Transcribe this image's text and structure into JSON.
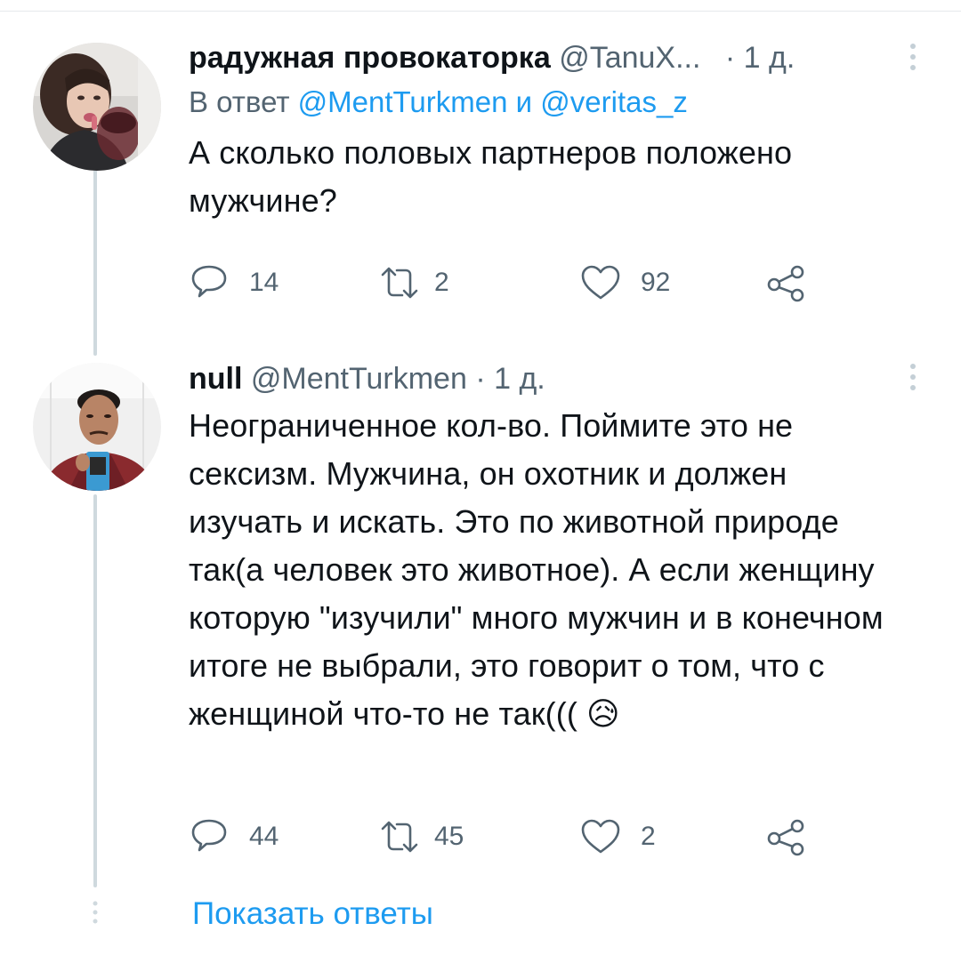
{
  "tweets": [
    {
      "display_name": "радужная провокаторка",
      "handle": "@TanuX...",
      "time": "· 1 д.",
      "reply_prefix": "В ответ",
      "reply_mention_1": "@MentTurkmen",
      "reply_and": "и",
      "reply_mention_2": "@veritas_z",
      "text": "А сколько половых партнеров положено мужчине?",
      "replies": "14",
      "retweets": "2",
      "likes": "92"
    },
    {
      "display_name": "null",
      "handle": "@MentTurkmen",
      "time": "· 1 д.",
      "text": "Неограниченное кол-во. Поймите это не сексизм. Мужчина, он охотник и должен изучать и искать. Это по животной природе так(а человек это животное). А если женщину которую \"изучили\" много мужчин и в конечном итоге не выбрали, это говорит о том, что с женщиной что-то не так(((",
      "emoji": "😥",
      "replies": "44",
      "retweets": "45",
      "likes": "2"
    }
  ],
  "show_replies_label": "Показать ответы",
  "colors": {
    "accent": "#1d9bf0",
    "secondary_text": "#536471",
    "primary_text": "#0f1419",
    "thread_line": "#cfd9de"
  },
  "icons": [
    "reply-icon",
    "retweet-icon",
    "like-icon",
    "share-icon",
    "more-icon",
    "avatar-image"
  ]
}
